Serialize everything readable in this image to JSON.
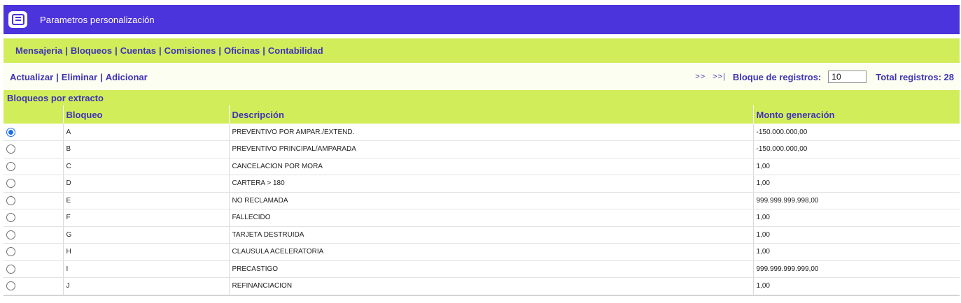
{
  "header": {
    "title": "Parametros personalización",
    "icon": "form-icon",
    "color": "#4b34dc"
  },
  "menu": {
    "items": [
      {
        "label": "Mensajeria"
      },
      {
        "label": "Bloqueos"
      },
      {
        "label": "Cuentas"
      },
      {
        "label": "Comisiones"
      },
      {
        "label": "Oficinas"
      },
      {
        "label": "Contabilidad"
      }
    ],
    "separator": "|",
    "background": "#d1ed59"
  },
  "actions": {
    "items": [
      {
        "label": "Actualizar"
      },
      {
        "label": "Eliminar"
      },
      {
        "label": "Adicionar"
      }
    ],
    "separator": "|"
  },
  "pager": {
    "next": ">>",
    "last": ">>|",
    "block_label": "Bloque de registros:",
    "block_value": "10",
    "total_label": "Total registros: 28"
  },
  "table": {
    "title": "Bloqueos por extracto",
    "columns": [
      {
        "label": ""
      },
      {
        "label": "Bloqueo"
      },
      {
        "label": "Descripción"
      },
      {
        "label": "Monto generación"
      }
    ],
    "rows": [
      {
        "selected": true,
        "bloqueo": "A",
        "descripcion": "PREVENTIVO POR AMPAR./EXTEND.",
        "monto": "-150.000.000,00"
      },
      {
        "selected": false,
        "bloqueo": "B",
        "descripcion": "PREVENTIVO PRINCIPAL/AMPARADA",
        "monto": "-150.000.000,00"
      },
      {
        "selected": false,
        "bloqueo": "C",
        "descripcion": "CANCELACION POR MORA",
        "monto": "1,00"
      },
      {
        "selected": false,
        "bloqueo": "D",
        "descripcion": "CARTERA > 180",
        "monto": "1,00"
      },
      {
        "selected": false,
        "bloqueo": "E",
        "descripcion": "NO RECLAMADA",
        "monto": "999.999.999.998,00"
      },
      {
        "selected": false,
        "bloqueo": "F",
        "descripcion": "FALLECIDO",
        "monto": "1,00"
      },
      {
        "selected": false,
        "bloqueo": "G",
        "descripcion": "TARJETA DESTRUIDA",
        "monto": "1,00"
      },
      {
        "selected": false,
        "bloqueo": "H",
        "descripcion": "CLAUSULA ACELERATORIA",
        "monto": "1,00"
      },
      {
        "selected": false,
        "bloqueo": "I",
        "descripcion": "PRECASTIGO",
        "monto": "999.999.999.999,00"
      },
      {
        "selected": false,
        "bloqueo": "J",
        "descripcion": "REFINANCIACION",
        "monto": "1,00"
      }
    ]
  }
}
